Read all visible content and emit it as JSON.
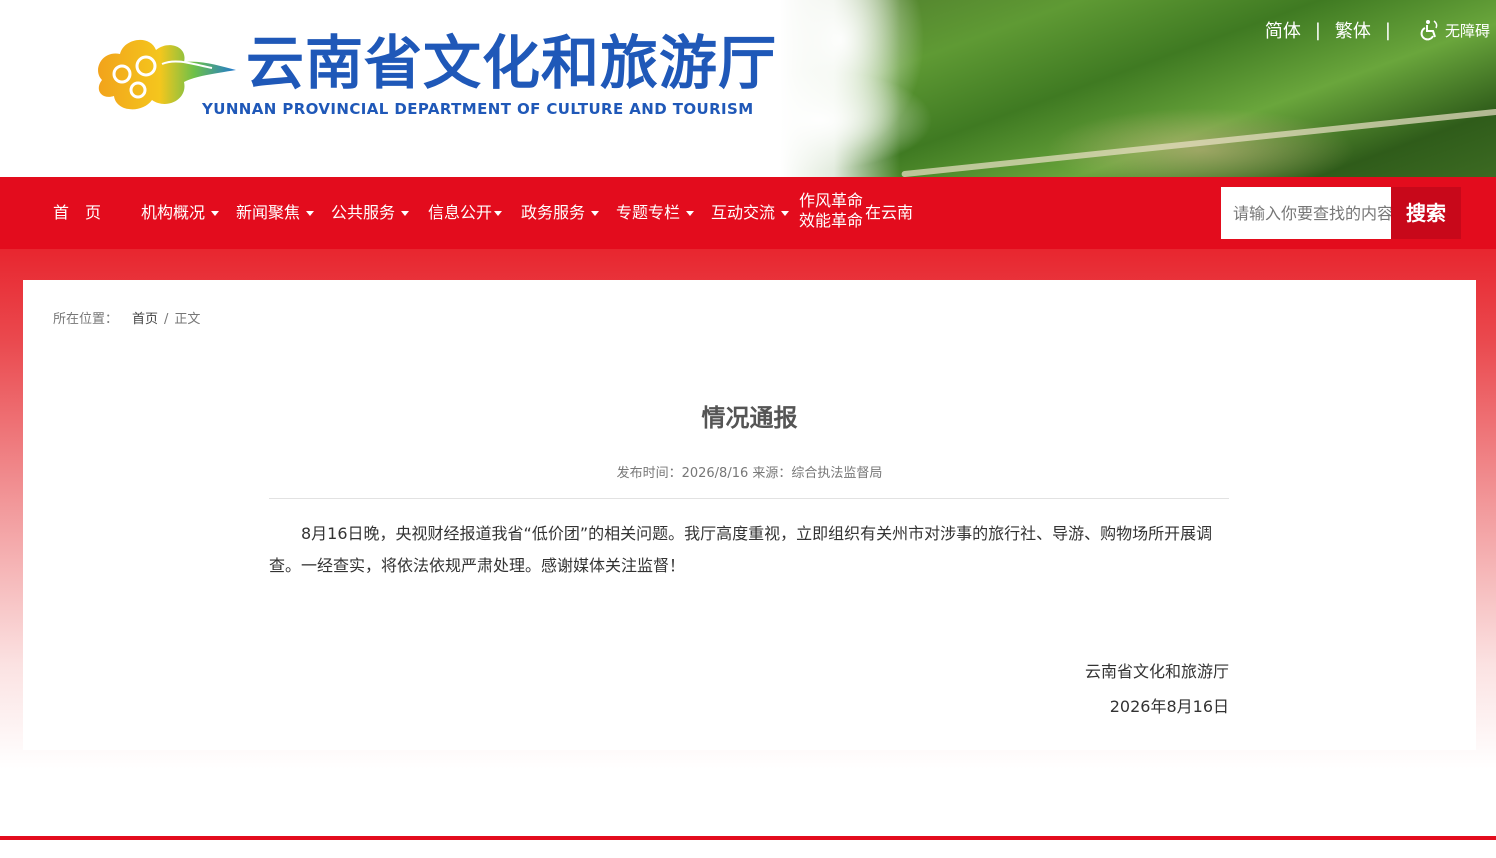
{
  "header": {
    "site_name_cn": "云南省文化和旅游厅",
    "site_name_en": "YUNNAN PROVINCIAL DEPARTMENT OF CULTURE AND TOURISM",
    "lang_simplified": "简体",
    "lang_separator_1": "|",
    "lang_traditional": "繁体",
    "lang_separator_2": "|",
    "accessibility": "无障碍"
  },
  "nav": {
    "home": "首　页",
    "items": [
      {
        "label": "机构概况"
      },
      {
        "label": "新闻聚焦"
      },
      {
        "label": "公共服务"
      },
      {
        "label": "信息公开"
      },
      {
        "label": "政务服务"
      },
      {
        "label": "专题专栏"
      },
      {
        "label": "互动交流"
      }
    ],
    "special_line1": "作风革命",
    "special_line2": "效能革命",
    "special_suffix": "在云南",
    "search_placeholder": "请输入你要查找的内容",
    "search_button": "搜索"
  },
  "breadcrumb": {
    "label": "所在位置：",
    "home": "首页",
    "separator": "/",
    "current": "正文"
  },
  "article": {
    "title": "情况通报",
    "meta": "发布时间：2026/8/16  来源：综合执法监督局",
    "body": "8月16日晚，央视财经报道我省“低价团”的相关问题。我厅高度重视，立即组织有关州市对涉事的旅行社、导游、购物场所开展调查。一经查实，将依法依规严肃处理。感谢媒体关注监督！",
    "signature_org": "云南省文化和旅游厅",
    "signature_date": "2026年8月16日"
  },
  "colors": {
    "brand_red": "#e30c1d",
    "logo_blue": "#1f58b8"
  }
}
